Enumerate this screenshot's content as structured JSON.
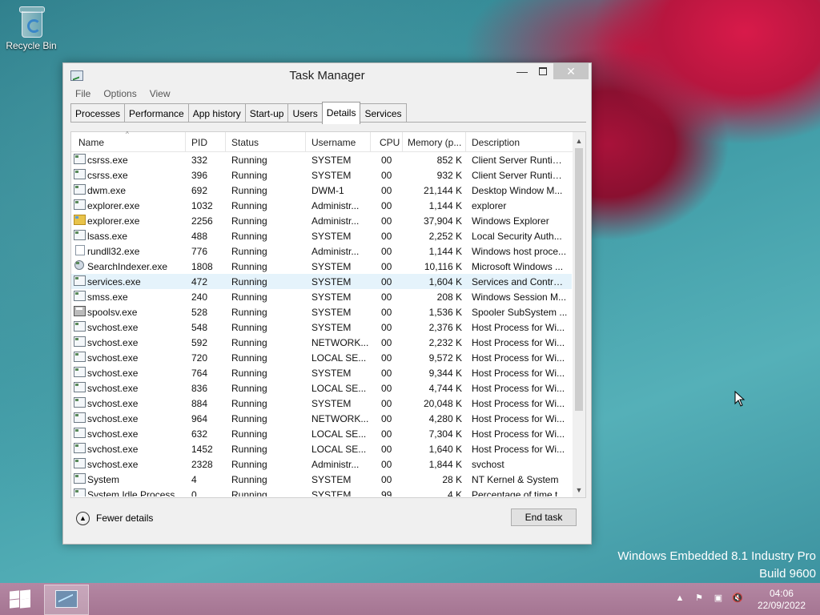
{
  "desktop": {
    "recycle_bin_label": "Recycle Bin",
    "watermark_line1": "Windows Embedded 8.1 Industry Pro",
    "watermark_line2": "Build 9600"
  },
  "window": {
    "title": "Task Manager",
    "min_symbol": "—",
    "close_symbol": "✕",
    "menu": [
      "File",
      "Options",
      "View"
    ],
    "tabs": [
      "Processes",
      "Performance",
      "App history",
      "Start-up",
      "Users",
      "Details",
      "Services"
    ],
    "active_tab": "Details",
    "columns": [
      "Name",
      "PID",
      "Status",
      "Username",
      "CPU",
      "Memory (p...",
      "Description"
    ],
    "rows": [
      {
        "name": "csrss.exe",
        "pid": "332",
        "status": "Running",
        "user": "SYSTEM",
        "cpu": "00",
        "mem": "852 K",
        "desc": "Client Server Runtim...",
        "icon": "generic"
      },
      {
        "name": "csrss.exe",
        "pid": "396",
        "status": "Running",
        "user": "SYSTEM",
        "cpu": "00",
        "mem": "932 K",
        "desc": "Client Server Runtim...",
        "icon": "generic"
      },
      {
        "name": "dwm.exe",
        "pid": "692",
        "status": "Running",
        "user": "DWM-1",
        "cpu": "00",
        "mem": "21,144 K",
        "desc": "Desktop Window M...",
        "icon": "generic"
      },
      {
        "name": "explorer.exe",
        "pid": "1032",
        "status": "Running",
        "user": "Administr...",
        "cpu": "00",
        "mem": "1,144 K",
        "desc": "explorer",
        "icon": "generic"
      },
      {
        "name": "explorer.exe",
        "pid": "2256",
        "status": "Running",
        "user": "Administr...",
        "cpu": "00",
        "mem": "37,904 K",
        "desc": "Windows Explorer",
        "icon": "explorer"
      },
      {
        "name": "lsass.exe",
        "pid": "488",
        "status": "Running",
        "user": "SYSTEM",
        "cpu": "00",
        "mem": "2,252 K",
        "desc": "Local Security Auth...",
        "icon": "generic"
      },
      {
        "name": "rundll32.exe",
        "pid": "776",
        "status": "Running",
        "user": "Administr...",
        "cpu": "00",
        "mem": "1,144 K",
        "desc": "Windows host proce...",
        "icon": "doc"
      },
      {
        "name": "SearchIndexer.exe",
        "pid": "1808",
        "status": "Running",
        "user": "SYSTEM",
        "cpu": "00",
        "mem": "10,116 K",
        "desc": "Microsoft Windows ...",
        "icon": "search"
      },
      {
        "name": "services.exe",
        "pid": "472",
        "status": "Running",
        "user": "SYSTEM",
        "cpu": "00",
        "mem": "1,604 K",
        "desc": "Services and Control...",
        "icon": "generic",
        "selected": true
      },
      {
        "name": "smss.exe",
        "pid": "240",
        "status": "Running",
        "user": "SYSTEM",
        "cpu": "00",
        "mem": "208 K",
        "desc": "Windows Session M...",
        "icon": "generic"
      },
      {
        "name": "spoolsv.exe",
        "pid": "528",
        "status": "Running",
        "user": "SYSTEM",
        "cpu": "00",
        "mem": "1,536 K",
        "desc": "Spooler SubSystem ...",
        "icon": "printer"
      },
      {
        "name": "svchost.exe",
        "pid": "548",
        "status": "Running",
        "user": "SYSTEM",
        "cpu": "00",
        "mem": "2,376 K",
        "desc": "Host Process for Wi...",
        "icon": "generic"
      },
      {
        "name": "svchost.exe",
        "pid": "592",
        "status": "Running",
        "user": "NETWORK...",
        "cpu": "00",
        "mem": "2,232 K",
        "desc": "Host Process for Wi...",
        "icon": "generic"
      },
      {
        "name": "svchost.exe",
        "pid": "720",
        "status": "Running",
        "user": "LOCAL SE...",
        "cpu": "00",
        "mem": "9,572 K",
        "desc": "Host Process for Wi...",
        "icon": "generic"
      },
      {
        "name": "svchost.exe",
        "pid": "764",
        "status": "Running",
        "user": "SYSTEM",
        "cpu": "00",
        "mem": "9,344 K",
        "desc": "Host Process for Wi...",
        "icon": "generic"
      },
      {
        "name": "svchost.exe",
        "pid": "836",
        "status": "Running",
        "user": "LOCAL SE...",
        "cpu": "00",
        "mem": "4,744 K",
        "desc": "Host Process for Wi...",
        "icon": "generic"
      },
      {
        "name": "svchost.exe",
        "pid": "884",
        "status": "Running",
        "user": "SYSTEM",
        "cpu": "00",
        "mem": "20,048 K",
        "desc": "Host Process for Wi...",
        "icon": "generic"
      },
      {
        "name": "svchost.exe",
        "pid": "964",
        "status": "Running",
        "user": "NETWORK...",
        "cpu": "00",
        "mem": "4,280 K",
        "desc": "Host Process for Wi...",
        "icon": "generic"
      },
      {
        "name": "svchost.exe",
        "pid": "632",
        "status": "Running",
        "user": "LOCAL SE...",
        "cpu": "00",
        "mem": "7,304 K",
        "desc": "Host Process for Wi...",
        "icon": "generic"
      },
      {
        "name": "svchost.exe",
        "pid": "1452",
        "status": "Running",
        "user": "LOCAL SE...",
        "cpu": "00",
        "mem": "1,640 K",
        "desc": "Host Process for Wi...",
        "icon": "generic"
      },
      {
        "name": "svchost.exe",
        "pid": "2328",
        "status": "Running",
        "user": "Administr...",
        "cpu": "00",
        "mem": "1,844 K",
        "desc": "svchost",
        "icon": "generic"
      },
      {
        "name": "System",
        "pid": "4",
        "status": "Running",
        "user": "SYSTEM",
        "cpu": "00",
        "mem": "28 K",
        "desc": "NT Kernel & System",
        "icon": "generic"
      },
      {
        "name": "System Idle Process",
        "pid": "0",
        "status": "Running",
        "user": "SYSTEM",
        "cpu": "99",
        "mem": "4 K",
        "desc": "Percentage of time t...",
        "icon": "generic"
      }
    ],
    "fewer_details_label": "Fewer details",
    "end_task_label": "End task"
  },
  "taskbar": {
    "time": "04:06",
    "date": "22/09/2022"
  }
}
